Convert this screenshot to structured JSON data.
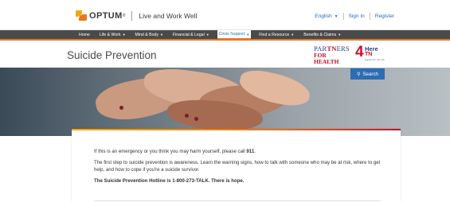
{
  "header": {
    "logo_word": "OPTUM",
    "logo_tm": "®",
    "site_name": "Live and Work Well",
    "language_label": "English",
    "sign_in_label": "Sign In",
    "register_label": "Register"
  },
  "nav": {
    "items": [
      {
        "label": "Home",
        "has_menu": false,
        "active": false
      },
      {
        "label": "Life & Work",
        "has_menu": true,
        "active": false
      },
      {
        "label": "Mind & Body",
        "has_menu": true,
        "active": false
      },
      {
        "label": "Financial & Legal",
        "has_menu": true,
        "active": false
      },
      {
        "label": "Crisis Support",
        "has_menu": true,
        "active": true
      },
      {
        "label": "Find a Resource",
        "has_menu": true,
        "active": false
      },
      {
        "label": "Benefits & Claims",
        "has_menu": true,
        "active": false
      }
    ]
  },
  "page": {
    "title": "Suicide Prevention",
    "search_label": "Search"
  },
  "partners_logo": {
    "line1_a": "PAR",
    "line1_b": "TN",
    "line1_c": "ERS",
    "line2": "FOR HEALTH"
  },
  "here4tn_logo": {
    "four": "4",
    "here": "Here",
    "tn": "TN",
    "sub": "Support for your job"
  },
  "content": {
    "p1_a": "If this is an emergency or you think you may harm yourself, please call ",
    "p1_b": "911",
    "p1_c": ".",
    "p2": "The first step to suicide prevention is awareness. Learn the warning signs, how to talk with someone who may be at risk, where to get help, and how to cope if you're a suicide survivor.",
    "p3": "The Suicide Prevention Hotline is 1-800-273-TALK. There is hope."
  },
  "colors": {
    "brand_orange": "#e87722",
    "brand_gold": "#f2a900",
    "link_blue": "#2c6db3",
    "nav_dark": "#4a4a4a"
  }
}
